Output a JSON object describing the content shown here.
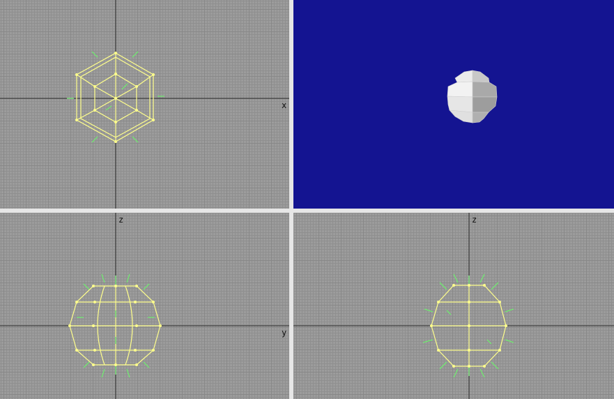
{
  "viewports": {
    "top": {
      "axis_label": "x"
    },
    "front": {
      "top_axis_label": "z",
      "right_axis_label": "y"
    },
    "side": {
      "top_axis_label": "z"
    }
  },
  "colors": {
    "grid_background": "#9c9c9c",
    "axis_line": "#2a2a2a",
    "wireframe": "#ffff8c",
    "normals": "#66ff66",
    "perspective_background": "#141491",
    "sphere_light": "#f0f0f0",
    "sphere_dark": "#a8a8a8"
  }
}
